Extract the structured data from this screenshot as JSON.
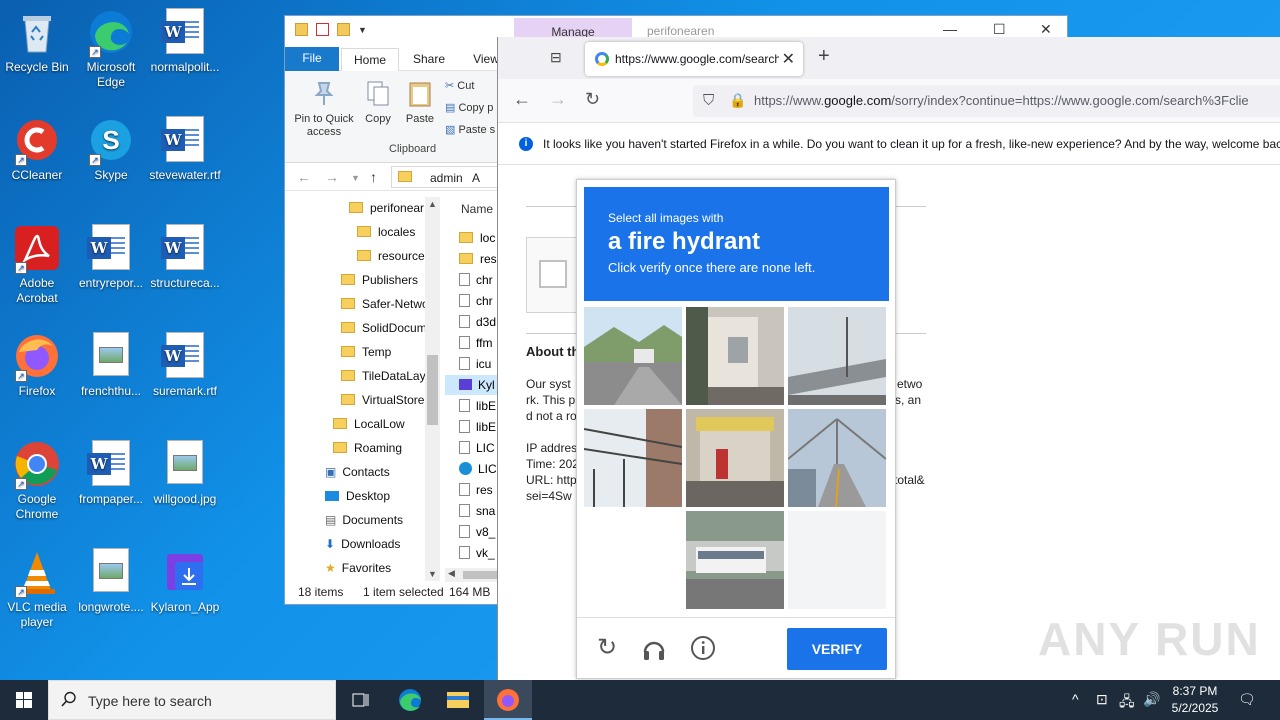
{
  "desktop": {
    "icons": [
      {
        "label": "Recycle Bin"
      },
      {
        "label": "Microsoft Edge"
      },
      {
        "label": "normalpolit..."
      },
      {
        "label": "CCleaner"
      },
      {
        "label": "Skype"
      },
      {
        "label": "stevewater.rtf"
      },
      {
        "label": "Adobe Acrobat"
      },
      {
        "label": "entryrepor..."
      },
      {
        "label": "structureca..."
      },
      {
        "label": "Firefox"
      },
      {
        "label": "frenchthu..."
      },
      {
        "label": "suremark.rtf"
      },
      {
        "label": "Google Chrome"
      },
      {
        "label": "frompaper..."
      },
      {
        "label": "willgood.jpg"
      },
      {
        "label": "VLC media player"
      },
      {
        "label": "longwrote...."
      },
      {
        "label": "Kylaron_App"
      }
    ]
  },
  "explorer": {
    "manage_tab": "Manage",
    "window_title": "perifonearen",
    "tabs": {
      "file": "File",
      "home": "Home",
      "share": "Share",
      "view": "View"
    },
    "ribbon": {
      "pin": "Pin to Quick access",
      "copy": "Copy",
      "paste": "Paste",
      "cut": "Cut",
      "copy_path": "Copy p",
      "paste_shortcut": "Paste s",
      "group_clipboard": "Clipboard"
    },
    "address": {
      "seg1": "admin",
      "seg2": "A"
    },
    "column_name": "Name",
    "tree": [
      "perifonear",
      "locales",
      "resource",
      "Publishers",
      "Safer-Netwo",
      "SolidDocum",
      "Temp",
      "TileDataLay",
      "VirtualStore",
      "LocalLow",
      "Roaming",
      "Contacts",
      "Desktop",
      "Documents",
      "Downloads",
      "Favorites"
    ],
    "files": [
      "loc",
      "res",
      "chr",
      "chr",
      "d3d",
      "ffm",
      "icu",
      "Kyl",
      "libE",
      "libE",
      "LIC",
      "LIC",
      "res",
      "sna",
      "v8_",
      "vk_"
    ],
    "status": {
      "items": "18 items",
      "selected": "1 item selected",
      "size": "164 MB"
    }
  },
  "firefox": {
    "tab_title": "https://www.google.com/search?q",
    "url_prefix": "https://www.",
    "url_domain": "google.com",
    "url_rest": "/sorry/index?continue=https://www.google.com/search%3Fclie",
    "notice": "It looks like you haven't started Firefox in a while. Do you want to clean it up for a fresh, like-new experience? And by the way, welcome back",
    "page": {
      "about_heading": "About th",
      "body_lines": [
        "Our syst",
        "rk. This p",
        "d not a ro"
      ],
      "body_right": [
        "etwo",
        "s, an"
      ],
      "ip": "IP addres",
      "time": "Time: 202",
      "url": "URL: http",
      "url_right": "total&",
      "sei": "sei=4Sw"
    }
  },
  "captcha": {
    "line1": "Select all images with",
    "line2": "a fire hydrant",
    "line3": "Click verify once there are none left.",
    "verify": "VERIFY"
  },
  "watermark": "ANY RUN",
  "taskbar": {
    "search_placeholder": "Type here to search",
    "time": "8:37 PM",
    "date": "5/2/2025"
  },
  "colors": {
    "accent": "#1a73e8",
    "desktop": "#0f7fd6",
    "taskbar": "#1d2b3a"
  }
}
